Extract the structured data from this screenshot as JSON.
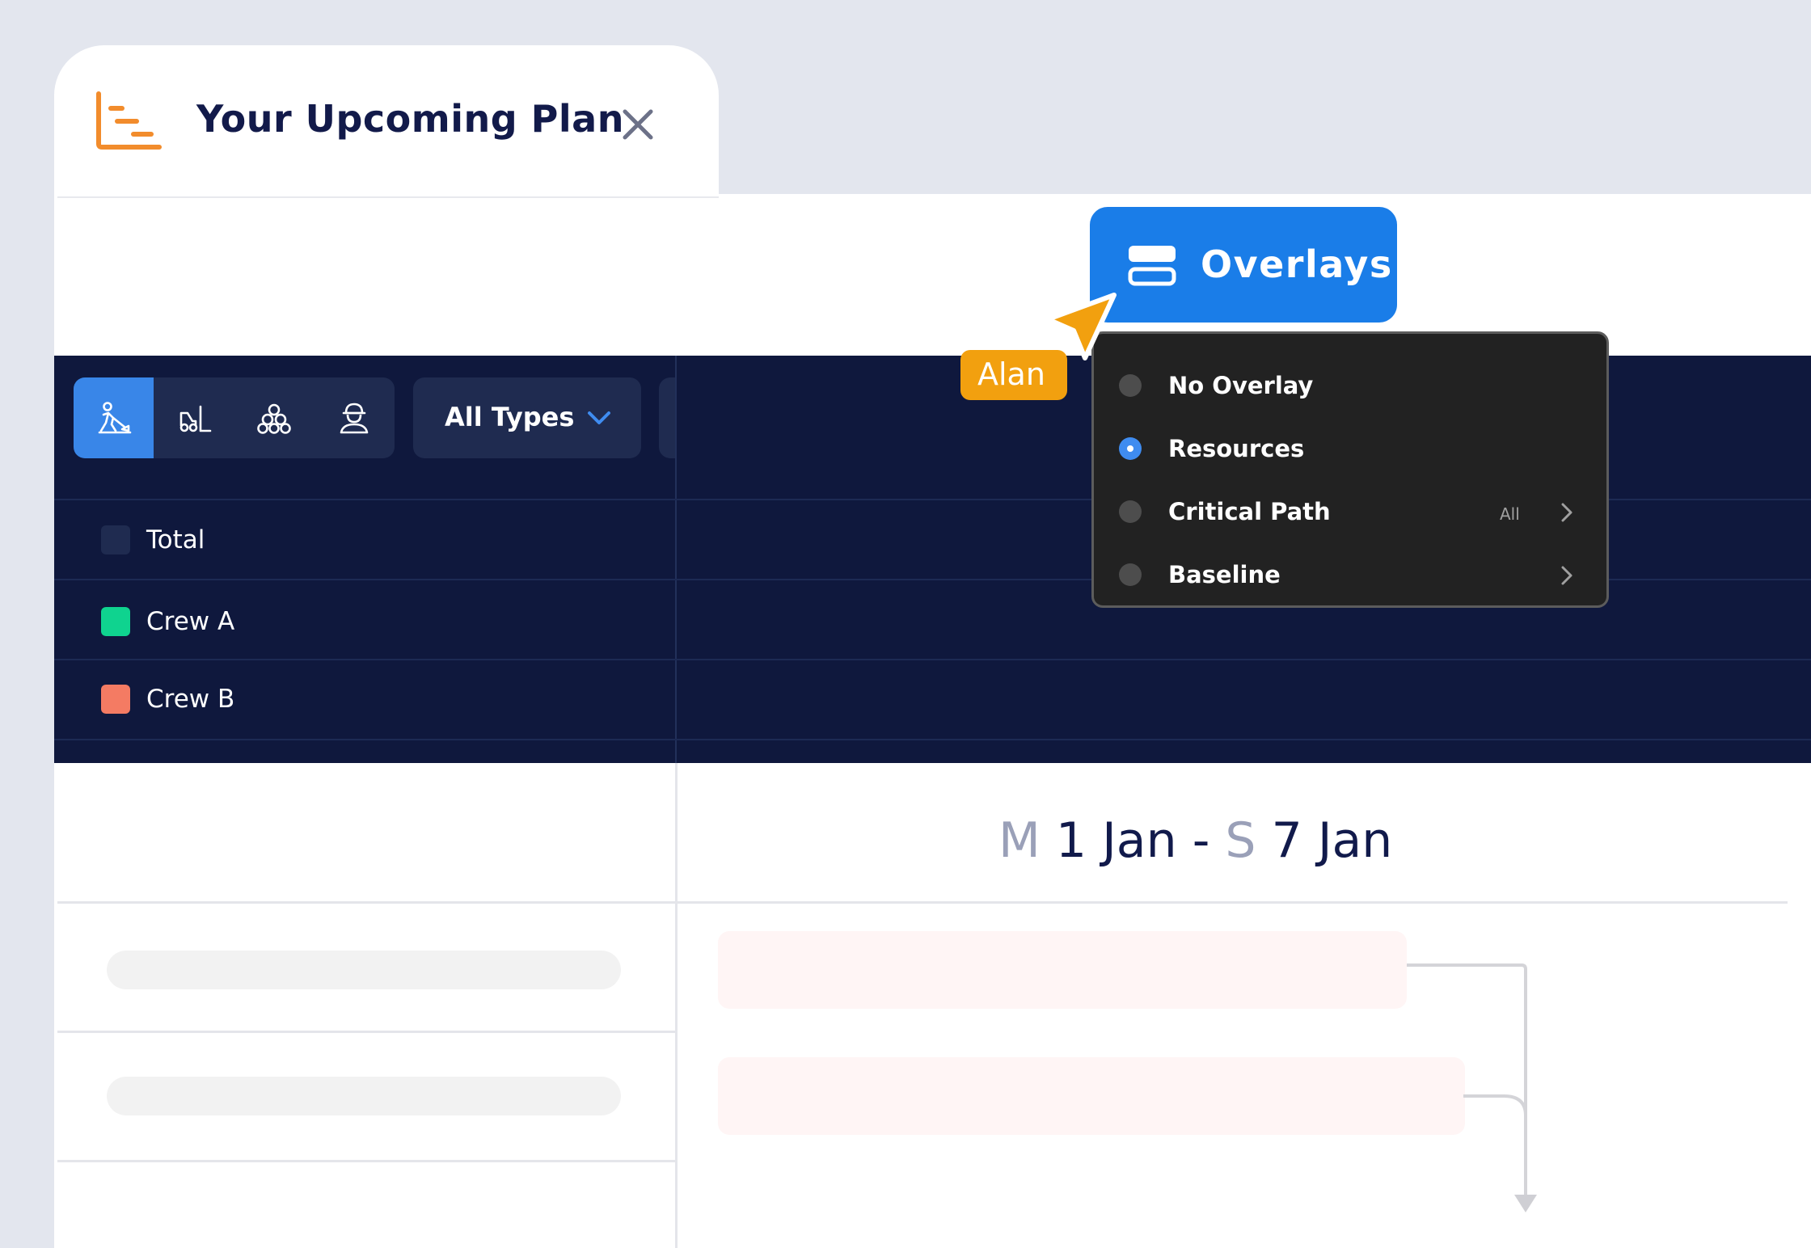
{
  "tab": {
    "title": "Your Upcoming Plan",
    "icon": "gantt-plan-icon",
    "close_icon": "close-icon",
    "accent": "#f28c2c"
  },
  "overlays_button": {
    "label": "Overlays",
    "icon": "layers-icon",
    "color": "#1a7de8"
  },
  "toolbar": {
    "segments": [
      {
        "icon": "worker-digging-icon",
        "active": true
      },
      {
        "icon": "forklift-icon",
        "active": false
      },
      {
        "icon": "materials-stack-icon",
        "active": false
      },
      {
        "icon": "hardhat-worker-icon",
        "active": false
      }
    ],
    "types_dropdown": {
      "label": "All Types",
      "icon": "chevron-down-icon"
    }
  },
  "legend": {
    "rows": [
      {
        "label": "Total",
        "color": "#1f2b50"
      },
      {
        "label": "Crew A",
        "color": "#0fd38f"
      },
      {
        "label": "Crew B",
        "color": "#f47b63"
      }
    ]
  },
  "overlay_menu": {
    "items": [
      {
        "label": "No Overlay",
        "selected": false,
        "badge": "",
        "has_submenu": false
      },
      {
        "label": "Resources",
        "selected": true,
        "badge": "",
        "has_submenu": false
      },
      {
        "label": "Critical Path",
        "selected": false,
        "badge": "All",
        "has_submenu": true
      },
      {
        "label": "Baseline",
        "selected": false,
        "badge": "",
        "has_submenu": true
      }
    ]
  },
  "cursor": {
    "user": "Alan",
    "color": "#f2a00f"
  },
  "schedule": {
    "start_day": "M",
    "start_date": "1 Jan",
    "separator": "-",
    "end_day": "S",
    "end_date": "7 Jan"
  }
}
